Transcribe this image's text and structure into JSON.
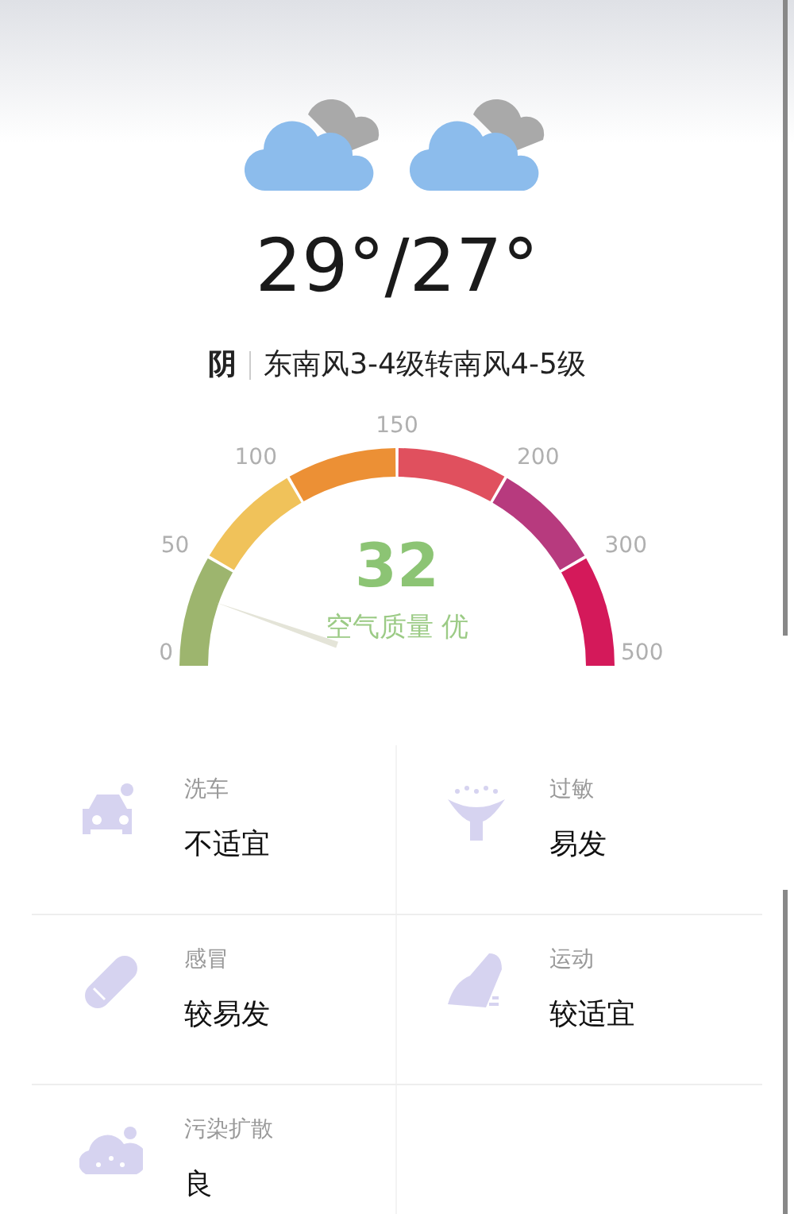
{
  "weather": {
    "temperature": "29°/27°",
    "condition": "阴",
    "wind": "东南风3-4级转南风4-5级"
  },
  "air_quality": {
    "value": "32",
    "label": "空气质量 优",
    "segments": [
      {
        "color": "#9db56e"
      },
      {
        "color": "#f0c25a"
      },
      {
        "color": "#ec9035"
      },
      {
        "color": "#e0505e"
      },
      {
        "color": "#b73a7e"
      },
      {
        "color": "#d4195a"
      }
    ],
    "ticks": [
      "0",
      "50",
      "100",
      "150",
      "200",
      "300",
      "500"
    ]
  },
  "indices": [
    {
      "kind": "car",
      "name": "洗车",
      "value": "不适宜"
    },
    {
      "kind": "allergy",
      "name": "过敏",
      "value": "易发"
    },
    {
      "kind": "cold",
      "name": "感冒",
      "value": "较易发"
    },
    {
      "kind": "sport",
      "name": "运动",
      "value": "较适宜"
    },
    {
      "kind": "pollution",
      "name": "污染扩散",
      "value": "良"
    }
  ]
}
